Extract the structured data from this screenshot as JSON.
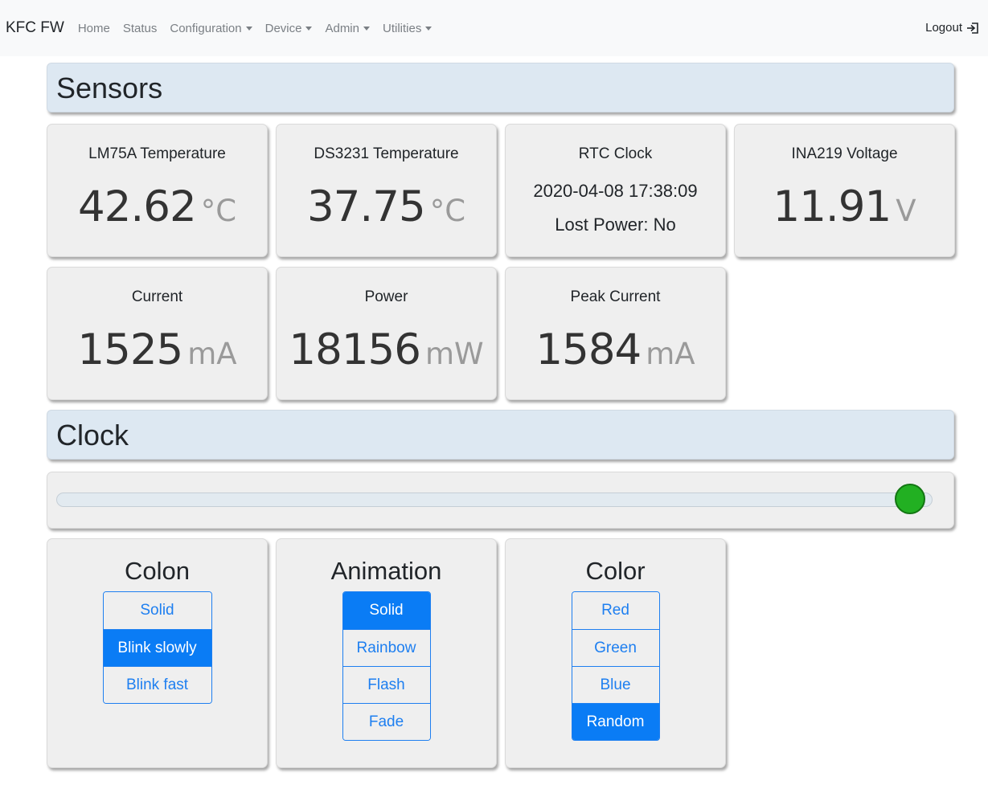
{
  "navbar": {
    "brand": "KFC FW",
    "items": [
      "Home",
      "Status",
      "Configuration",
      "Device",
      "Admin",
      "Utilities"
    ],
    "logout": "Logout"
  },
  "sensors": {
    "title": "Sensors",
    "lm75a": {
      "label": "LM75A Temperature",
      "value": "42.62",
      "unit": "°C"
    },
    "ds3231": {
      "label": "DS3231 Temperature",
      "value": "37.75",
      "unit": "°C"
    },
    "rtc": {
      "label": "RTC Clock",
      "datetime": "2020-04-08 17:38:09",
      "lost_power": "Lost Power: No"
    },
    "ina219": {
      "label": "INA219 Voltage",
      "value": "11.91",
      "unit": "V"
    },
    "current": {
      "label": "Current",
      "value": "1525",
      "unit": "mA"
    },
    "power": {
      "label": "Power",
      "value": "18156",
      "unit": "mW"
    },
    "peak": {
      "label": "Peak Current",
      "value": "1584",
      "unit": "mA"
    }
  },
  "clock": {
    "title": "Clock",
    "brightness_fraction": 1.0,
    "thumb_color": "#22b022",
    "colon": {
      "title": "Colon",
      "options": [
        "Solid",
        "Blink slowly",
        "Blink fast"
      ],
      "selected": "Blink slowly"
    },
    "animation": {
      "title": "Animation",
      "options": [
        "Solid",
        "Rainbow",
        "Flash",
        "Fade"
      ],
      "selected": "Solid"
    },
    "color": {
      "title": "Color",
      "options": [
        "Red",
        "Green",
        "Blue",
        "Random"
      ],
      "selected": "Random"
    }
  },
  "colors": {
    "accent": "#0a7cf5",
    "section_bg": "#dde8f2",
    "card_bg": "#efefef"
  }
}
